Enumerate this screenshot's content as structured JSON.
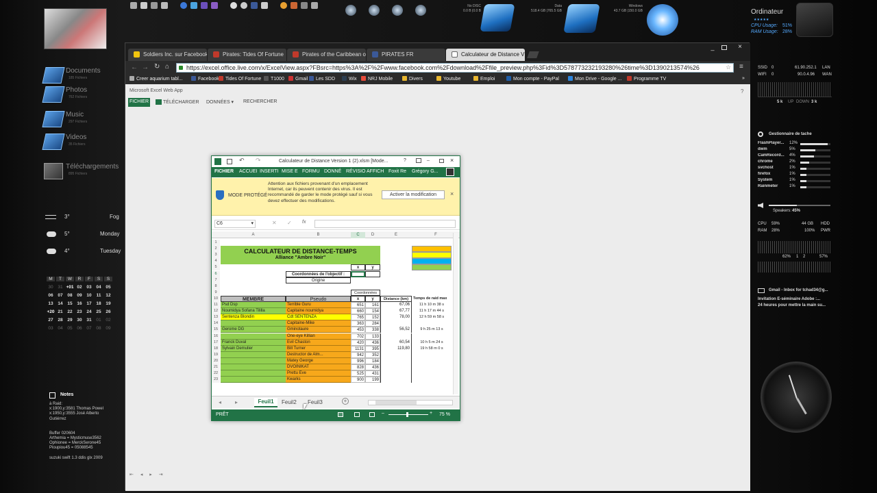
{
  "taskbar": {
    "drives": [
      {
        "label": "No DISC",
        "detail": "0.0 B   |0.0 B"
      },
      {
        "label": "Data",
        "detail": "518.4 GB  |765.5 GB"
      },
      {
        "label": "Windows",
        "detail": "43.7 GB  |150.0 GB"
      }
    ],
    "computer_label": "Ordinateur",
    "cpu_label": "CPU Usage:",
    "cpu_value": "51%",
    "ram_label": "RAM Usage:",
    "ram_value": "28%"
  },
  "libraries": [
    {
      "name": "Documents",
      "count": "185 Fichiers"
    },
    {
      "name": "Photos",
      "count": "762 Fichiers"
    },
    {
      "name": "Music",
      "count": "297 Fichiers"
    },
    {
      "name": "Videos",
      "count": "35 Fichiers"
    },
    {
      "name": "Téléchargements",
      "count": "895 Fichiers"
    }
  ],
  "weather": [
    {
      "temp": "3°",
      "desc": "Fog"
    },
    {
      "temp": "5°",
      "desc": "Monday"
    },
    {
      "temp": "4°",
      "desc": "Tuesday"
    }
  ],
  "calendar": {
    "days": [
      "M",
      "T",
      "W",
      "R",
      "F",
      "S",
      "S"
    ],
    "rows": [
      [
        "30",
        "31",
        "+01",
        "02",
        "03",
        "04",
        "05"
      ],
      [
        "06",
        "07",
        "08",
        "09",
        "10",
        "11",
        "12"
      ],
      [
        "13",
        "14",
        "15",
        "16",
        "17",
        "18",
        "19"
      ],
      [
        "+20",
        "21",
        "22",
        "23",
        "24",
        "25",
        "26"
      ],
      [
        "27",
        "28",
        "29",
        "30",
        "31",
        "01",
        "02"
      ],
      [
        "03",
        "04",
        "05",
        "06",
        "07",
        "08",
        "09"
      ]
    ]
  },
  "notes": {
    "title": "Notes",
    "lines": [
      "à Raid:",
      "x:1900,y:3581 Thomas Powel",
      "x:1950,y:3555 José Alberto",
      "Gutiérrez",
      "",
      "",
      "Buffer 020604",
      "Arthemia = Mysticmuse3562",
      "Ophionee = MerckSerone45",
      "Pioupiou45 = 05088545",
      "",
      "suzuki swift 1.3 ddis glx 2009"
    ]
  },
  "network": {
    "ssid_label": "SSID",
    "ssid_val": "0",
    "ssid_ip": "61.90.252.1",
    "ssid_tag": "LAN",
    "wifi_label": "WIFI",
    "wifi_val": "0",
    "wifi_ip": "90.0.4.96",
    "wifi_tag": "WAN",
    "up_label": "5 k",
    "up_tag": "UP",
    "down_label": "DOWN",
    "down_val": "3 k"
  },
  "taskmgr": {
    "title": "Gestionnaire de tache",
    "procs": [
      {
        "name": "FlashPlayer...",
        "pct": "12%",
        "level": 0.9
      },
      {
        "name": "dwm",
        "pct": "5%",
        "level": 0.5
      },
      {
        "name": "CamRecord...",
        "pct": "4%",
        "level": 0.45
      },
      {
        "name": "chrome",
        "pct": "2%",
        "level": 0.3
      },
      {
        "name": "svchost",
        "pct": "1%",
        "level": 0.2
      },
      {
        "name": "firefox",
        "pct": "1%",
        "level": 0.2
      },
      {
        "name": "System",
        "pct": "1%",
        "level": 0.2
      },
      {
        "name": "Rainmeter",
        "pct": "1%",
        "level": 0.2
      }
    ]
  },
  "speakers": {
    "label": "Speakers:",
    "value": "45%"
  },
  "sysstats": {
    "cpu_label": "CPU",
    "cpu_val": "59%",
    "hdd_val": "44 GB",
    "hdd_label": "HDD",
    "ram_label": "RAM",
    "ram_val": "28%",
    "pwr_val": "100%",
    "pwr_label": "PWR",
    "a": "62%",
    "b": "1",
    "c": "2",
    "d": "57%"
  },
  "gmail": {
    "title": "Gmail - Inbox for tchad34@g...",
    "line1": "Invitation E-séminaire Adobe :...",
    "line2": "24 heures pour mettre la main su..."
  },
  "browser": {
    "tabs": [
      "Soldiers Inc. sur Facebook",
      "Pirates: Tides Of Fortune",
      "Pirates of the Caribbean o",
      "PIRATES FR",
      "Calculateur de Distance V"
    ],
    "url": "https://excel.office.live.com/x/ExcelView.aspx?FBsrc=https%3A%2F%2Fwww.facebook.com%2Fdownload%2Ffile_preview.php%3Fid%3D578773232193280%26time%3D1390213574%26",
    "bookmarks": [
      "Creer aquarium tabl...",
      "Facebook",
      "Tides Of Fortune",
      "T1000",
      "Gmail",
      "Les SDD",
      "Wix",
      "NRJ Mobile",
      "Divers",
      "Youtube",
      "Emploi",
      "Mon compte - PayPal",
      "Mon Drive - Google ...",
      "Programme TV"
    ],
    "app_title": "Microsoft Excel Web App",
    "ribbon": [
      "FICHIER",
      "TÉLÉCHARGER",
      "DONNÉES ▾",
      "RECHERCHER"
    ]
  },
  "excel": {
    "title": "Calculateur de  Distance Version 1 (2).xlsm  [Mode...",
    "menu": [
      "FICHIER",
      "ACCUEI",
      "INSERTI",
      "MISE E",
      "FORMU",
      "DONNÉ",
      "RÉVISIO",
      "AFFICH",
      "Foxit Re",
      "Grégory G..."
    ],
    "protect_label": "MODE PROTÉGÉ",
    "protect_text": "Attention aux fichiers provenant d'un emplacement Internet, car ils peuvent contenir des virus. Il est recommandé de garder le mode protégé sauf si vous devez effectuer des modifications.",
    "protect_button": "Activer la modification",
    "namebox": "C6",
    "columns": [
      "A",
      "B",
      "C",
      "D",
      "E",
      "F"
    ],
    "title1": "CALCULATEUR DE DISTANCE-TEMPS",
    "title2": "Alliance \"Ambre Noir\"",
    "obj_label": "Coordonnées de l'objectif :",
    "origin": "Origine",
    "x": "x",
    "y": "y",
    "coords_label": "Coordonnées",
    "membre": "MEMBRE",
    "pseudo": "Pseudo",
    "distance": "Distance (km)",
    "temps": "Temps de raid max",
    "rows": [
      {
        "r": "11",
        "m": "Psd Dsp",
        "p": "Terrible Guru",
        "x": "651",
        "y": "161",
        "d": "67,06",
        "t": "11 h 10 m 38 s"
      },
      {
        "r": "12",
        "m": "Noumidya Sofana Tililla",
        "p": "Capitaine noumidya",
        "x": "660",
        "y": "154",
        "d": "67,77",
        "t": "11 h 17 m 44 s"
      },
      {
        "r": "13",
        "m": "Sentenza Blondin",
        "p": "Cdt SENTENZA",
        "x": "765",
        "y": "152",
        "d": "78,00",
        "t": "12 h 59 m 58 s"
      },
      {
        "r": "14",
        "m": "",
        "p": "Capitaine-Mike",
        "x": "363",
        "y": "284",
        "d": "",
        "t": ""
      },
      {
        "r": "15",
        "m": "Gerome DG",
        "p": "Gminotaure",
        "x": "453",
        "y": "338",
        "d": "56,52",
        "t": "9 h 25 m 13 s"
      },
      {
        "r": "16",
        "m": "",
        "p": "One-eye Killian",
        "x": "702",
        "y": "133",
        "d": "",
        "t": ""
      },
      {
        "r": "17",
        "m": "Franck Duval",
        "p": "Evil Chaston",
        "x": "420",
        "y": "436",
        "d": "60,54",
        "t": "10 h 5 m 24 s"
      },
      {
        "r": "18",
        "m": "Sylvain Demulier",
        "p": "Bill Turner",
        "x": "1131",
        "y": "395",
        "d": "119,80",
        "t": "19 h 58 m 0 s"
      },
      {
        "r": "19",
        "m": "",
        "p": "Destructor de Alm...",
        "x": "942",
        "y": "352",
        "d": "",
        "t": ""
      },
      {
        "r": "20",
        "m": "",
        "p": "Matey George",
        "x": "996",
        "y": "184",
        "d": "",
        "t": ""
      },
      {
        "r": "21",
        "m": "",
        "p": "DVOINIKAT",
        "x": "828",
        "y": "436",
        "d": "",
        "t": ""
      },
      {
        "r": "22",
        "m": "",
        "p": "Prettu Eve",
        "x": "525",
        "y": "431",
        "d": "",
        "t": ""
      },
      {
        "r": "23",
        "m": "",
        "p": "Kwarks",
        "x": "900",
        "y": "199",
        "d": "",
        "t": ""
      }
    ],
    "sheets": [
      "Feuil1",
      "Feuil2",
      "Feuil3"
    ],
    "status": "PRÊT",
    "zoom": "75 %"
  },
  "colors": {
    "excel_green": "#217346",
    "header_green": "#92d050",
    "orange": "#f7a81b",
    "yellow": "#ffff00",
    "legend": [
      "#ffc000",
      "#ffff00",
      "#00b0f0",
      "#92d050"
    ]
  }
}
